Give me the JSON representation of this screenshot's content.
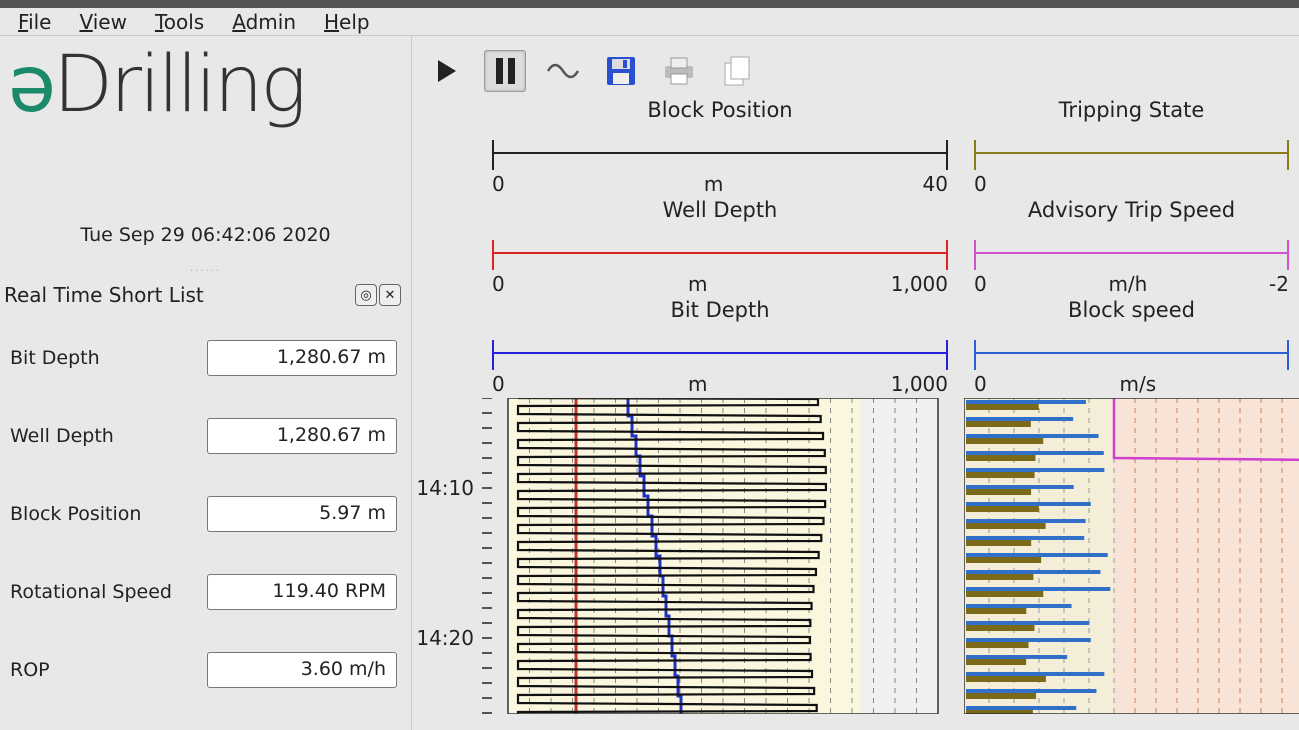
{
  "menubar": {
    "file": "File",
    "view": "View",
    "tools": "Tools",
    "admin": "Admin",
    "help": "Help"
  },
  "logo": {
    "prefix": "ə",
    "rest": "Drilling"
  },
  "timestamp": "Tue Sep 29 06:42:06 2020",
  "panel": {
    "title": "Real Time Short List",
    "rows": [
      {
        "label": "Bit Depth",
        "value": "1,280.67 m"
      },
      {
        "label": "Well Depth",
        "value": "1,280.67 m"
      },
      {
        "label": "Block Position",
        "value": "5.97 m"
      },
      {
        "label": "Rotational Speed",
        "value": "119.40 RPM"
      },
      {
        "label": "ROP",
        "value": "3.60 m/h"
      }
    ]
  },
  "toolbar": {
    "play": "Play",
    "pause": "Pause",
    "wave": "Signal",
    "save": "Save",
    "print": "Print",
    "copy": "Copy"
  },
  "tracks": {
    "col1": [
      {
        "title": "Block Position",
        "min": "0",
        "unit": "m",
        "max": "40",
        "color": "#222"
      },
      {
        "title": "Well Depth",
        "min": "0",
        "unit": "m",
        "max": "1,000",
        "color": "#d22"
      },
      {
        "title": "Bit Depth",
        "min": "0",
        "unit": "m",
        "max": "1,000",
        "color": "#22d"
      }
    ],
    "col2": [
      {
        "title": "Tripping State",
        "min": "0",
        "unit": "",
        "max": "",
        "color": "#8a7a1a"
      },
      {
        "title": "Advisory Trip Speed",
        "min": "0",
        "unit": "m/h",
        "max": "-2",
        "color": "#d050d0"
      },
      {
        "title": "Block speed",
        "min": "0",
        "unit": "m/s",
        "max": "",
        "color": "#2a60d0"
      }
    ]
  },
  "time_ticks": [
    {
      "label": "14:10",
      "pos": 78
    },
    {
      "label": "14:20",
      "pos": 228
    }
  ],
  "colors": {
    "plot_bg_left": "#fbf7df",
    "plot_bg_right": "#f7e4d6",
    "grid": "#888",
    "red": "#c83030",
    "blue": "#2030c0",
    "black": "#111",
    "olive": "#7a6a1a",
    "steel": "#3070c8",
    "magenta": "#d040d0",
    "orange_grid": "#c88050"
  }
}
